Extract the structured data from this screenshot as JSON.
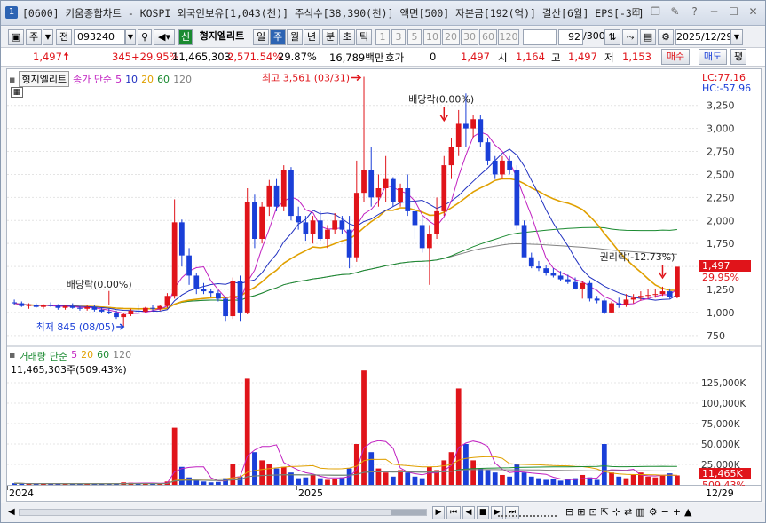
{
  "window": {
    "number": "1",
    "title": "[0600] 키움종합차트 - KOSPI 외국인보유[1,043(천)] 주식수[38,390(천)] 액면[500] 자본금[192(억)] 결산[6월] EPS[-34]",
    "buttons": [
      "⊞",
      "❐",
      "✎",
      "?",
      "─",
      "☐",
      "✕"
    ]
  },
  "toolbar": {
    "left_btns": [
      "주",
      "전"
    ],
    "code": "093240",
    "sin": "신",
    "name": "형지엘리트",
    "period_tabs": [
      "일",
      "주",
      "월",
      "년",
      "분",
      "초",
      "틱"
    ],
    "selected_period": "주",
    "interval_btns": [
      "1",
      "3",
      "5",
      "10",
      "20",
      "30",
      "60",
      "120"
    ],
    "count": "92",
    "count_total": "/300",
    "date": "2025/12/29"
  },
  "quote": {
    "price": "1,497",
    "change": "345",
    "change_pct": "+29.95%",
    "volume": "11,465,303",
    "vol_ratio": "2,571.54%",
    "turnover": "29.87%",
    "amount": "16,789백만",
    "hoga_label": "호가",
    "hoga": "0",
    "hoga_price": "1,497",
    "open_label": "시",
    "open": "1,164",
    "high_label": "고",
    "high": "1,497",
    "low_label": "저",
    "low": "1,153",
    "buy": "매수",
    "sell": "매도",
    "eval": "평"
  },
  "price_panel": {
    "name_tag": "형지엘리트",
    "ma_label": "종가 단순",
    "ma_periods": [
      "5",
      "10",
      "20",
      "60",
      "120"
    ],
    "lc": "LC:77.16",
    "hc": "HC:-57.96",
    "current_tag": "1,497",
    "current_pct": "29.95%",
    "annotations": {
      "high": "최고 3,561 (03/31)",
      "low": "최저 845 (08/05)",
      "div1": "배당락(0.00%)",
      "div2": "배당락(0.00%)",
      "rights": "권리락(-12.73%)"
    },
    "y_ticks": [
      "3,250",
      "3,000",
      "2,750",
      "2,500",
      "2,250",
      "2,000",
      "1,750",
      "1,500",
      "1,250",
      "1,000",
      "750"
    ]
  },
  "volume_panel": {
    "label": "거래량",
    "ma_label": "단순",
    "ma_periods": [
      "5",
      "20",
      "60",
      "120"
    ],
    "value": "11,465,303주(509.43%)",
    "current_tag": "11,465K",
    "current_pct": "509.43%",
    "y_ticks": [
      "125,000K",
      "100,000K",
      "75,000K",
      "50,000K",
      "25,000K"
    ]
  },
  "x_axis": {
    "labels": [
      "2024",
      "2025"
    ],
    "right_label": "12/29"
  },
  "colors": {
    "up": "#e0141a",
    "down": "#1a3fd8",
    "ma5": "#c020c0",
    "ma10": "#2030c0",
    "ma20": "#e0a000",
    "ma60": "#1a8a30",
    "ma120": "#808080"
  },
  "chart_data": {
    "type": "candlestick",
    "title": "",
    "ylim": [
      700,
      3450
    ],
    "candles": [
      [
        1110,
        1140,
        1080,
        1100
      ],
      [
        1100,
        1120,
        1060,
        1070
      ],
      [
        1070,
        1100,
        1040,
        1080
      ],
      [
        1080,
        1100,
        1050,
        1060
      ],
      [
        1060,
        1090,
        1040,
        1080
      ],
      [
        1080,
        1110,
        1060,
        1070
      ],
      [
        1070,
        1090,
        1030,
        1050
      ],
      [
        1050,
        1080,
        1030,
        1070
      ],
      [
        1070,
        1100,
        1040,
        1050
      ],
      [
        1050,
        1070,
        1020,
        1040
      ],
      [
        1040,
        1080,
        1020,
        1060
      ],
      [
        1060,
        1080,
        1010,
        1030
      ],
      [
        1030,
        1050,
        990,
        1010
      ],
      [
        1010,
        1040,
        980,
        990
      ],
      [
        990,
        1020,
        930,
        950
      ],
      [
        950,
        1000,
        845,
        980
      ],
      [
        980,
        1040,
        960,
        1020
      ],
      [
        1020,
        1090,
        1000,
        1010
      ],
      [
        1010,
        1060,
        990,
        1050
      ],
      [
        1050,
        1080,
        1020,
        1040
      ],
      [
        1040,
        1080,
        1020,
        1070
      ],
      [
        1070,
        1210,
        1050,
        1180
      ],
      [
        1180,
        2230,
        1150,
        1980
      ],
      [
        1980,
        2010,
        1500,
        1620
      ],
      [
        1620,
        1700,
        1300,
        1400
      ],
      [
        1400,
        1430,
        1200,
        1250
      ],
      [
        1250,
        1320,
        1200,
        1230
      ],
      [
        1230,
        1260,
        1170,
        1210
      ],
      [
        1210,
        1240,
        1120,
        1150
      ],
      [
        1150,
        1170,
        900,
        960
      ],
      [
        960,
        1380,
        930,
        1340
      ],
      [
        1340,
        1400,
        900,
        1000
      ],
      [
        1000,
        2350,
        980,
        2200
      ],
      [
        2200,
        2280,
        1700,
        1800
      ],
      [
        1800,
        2200,
        1750,
        2150
      ],
      [
        2150,
        2440,
        2050,
        2380
      ],
      [
        2380,
        2450,
        2100,
        2150
      ],
      [
        2150,
        2600,
        2100,
        2550
      ],
      [
        2550,
        2580,
        2000,
        2050
      ],
      [
        2050,
        2150,
        1900,
        1980
      ],
      [
        1980,
        2050,
        1780,
        1850
      ],
      [
        1850,
        2050,
        1750,
        2000
      ],
      [
        2000,
        2100,
        1780,
        1800
      ],
      [
        1800,
        1950,
        1700,
        1900
      ],
      [
        1900,
        2080,
        1850,
        2000
      ],
      [
        2000,
        2050,
        1850,
        1900
      ],
      [
        1900,
        2050,
        1480,
        1600
      ],
      [
        1600,
        2650,
        1550,
        2300
      ],
      [
        2300,
        3561,
        2200,
        2550
      ],
      [
        2550,
        2800,
        2150,
        2250
      ],
      [
        2250,
        2500,
        2150,
        2350
      ],
      [
        2350,
        2700,
        2200,
        2450
      ],
      [
        2450,
        2470,
        2150,
        2200
      ],
      [
        2200,
        2400,
        2150,
        2350
      ],
      [
        2350,
        2500,
        2050,
        2100
      ],
      [
        2100,
        2200,
        1800,
        1950
      ],
      [
        1950,
        2050,
        1650,
        1700
      ],
      [
        1700,
        1950,
        1300,
        1850
      ],
      [
        1850,
        2250,
        1800,
        2100
      ],
      [
        2100,
        2700,
        2050,
        2600
      ],
      [
        2600,
        2900,
        2450,
        2800
      ],
      [
        2800,
        3200,
        2700,
        3050
      ],
      [
        3050,
        3380,
        2800,
        3000
      ],
      [
        3000,
        3150,
        2900,
        3100
      ],
      [
        3100,
        3150,
        2800,
        2850
      ],
      [
        2850,
        2900,
        2600,
        2650
      ],
      [
        2650,
        2700,
        2450,
        2500
      ],
      [
        2500,
        2700,
        2450,
        2650
      ],
      [
        2650,
        2700,
        2500,
        2550
      ],
      [
        2550,
        2600,
        1900,
        1950
      ],
      [
        1950,
        2000,
        1700,
        1600
      ],
      [
        1600,
        1650,
        1480,
        1500
      ],
      [
        1500,
        1560,
        1450,
        1480
      ],
      [
        1480,
        1520,
        1400,
        1430
      ],
      [
        1430,
        1480,
        1380,
        1400
      ],
      [
        1400,
        1450,
        1340,
        1360
      ],
      [
        1360,
        1410,
        1310,
        1330
      ],
      [
        1330,
        1380,
        1250,
        1260
      ],
      [
        1260,
        1340,
        1150,
        1320
      ],
      [
        1320,
        1350,
        1120,
        1150
      ],
      [
        1150,
        1180,
        1100,
        1130
      ],
      [
        1130,
        1150,
        980,
        1000
      ],
      [
        1000,
        1120,
        990,
        1100
      ],
      [
        1100,
        1160,
        1050,
        1080
      ],
      [
        1080,
        1200,
        1060,
        1140
      ],
      [
        1140,
        1200,
        1100,
        1160
      ],
      [
        1160,
        1230,
        1130,
        1180
      ],
      [
        1180,
        1250,
        1150,
        1190
      ],
      [
        1190,
        1250,
        1160,
        1200
      ],
      [
        1200,
        1280,
        1180,
        1230
      ],
      [
        1230,
        1260,
        1150,
        1164
      ],
      [
        1164,
        1497,
        1153,
        1497
      ]
    ],
    "volume_k": [
      2000,
      1500,
      1200,
      1800,
      1300,
      1100,
      1500,
      1200,
      1000,
      1400,
      1100,
      1300,
      1200,
      1000,
      1800,
      3000,
      2500,
      2000,
      1500,
      1800,
      1600,
      4000,
      70000,
      22000,
      9000,
      5000,
      4000,
      3000,
      3500,
      8000,
      25000,
      10000,
      130000,
      40000,
      30000,
      25000,
      20000,
      22000,
      15000,
      8000,
      9000,
      12000,
      8000,
      6000,
      7000,
      9000,
      20000,
      50000,
      140000,
      40000,
      20000,
      15000,
      10000,
      18000,
      15000,
      10000,
      8000,
      22000,
      18000,
      30000,
      40000,
      118000,
      50000,
      30000,
      20000,
      18000,
      15000,
      12000,
      10000,
      25000,
      15000,
      10000,
      8000,
      6000,
      7000,
      5000,
      6000,
      8000,
      12000,
      9000,
      6000,
      50000,
      15000,
      10000,
      8000,
      12000,
      15000,
      10000,
      9000,
      12000,
      14000,
      11465
    ]
  }
}
